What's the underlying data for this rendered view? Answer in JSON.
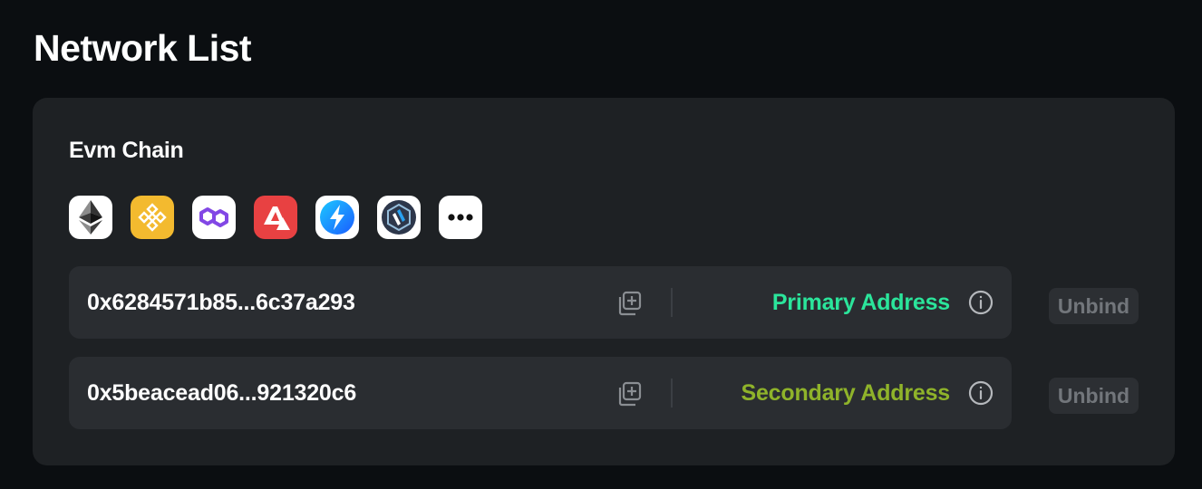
{
  "page": {
    "title": "Network List"
  },
  "evm": {
    "title": "Evm Chain",
    "chains": [
      {
        "icon": "ethereum-icon",
        "bg": "#ffffff"
      },
      {
        "icon": "bnb-icon",
        "bg": "#f3ba2f"
      },
      {
        "icon": "polygon-icon",
        "bg": "#ffffff"
      },
      {
        "icon": "avalanche-icon",
        "bg": "#e84142"
      },
      {
        "icon": "zksync-icon",
        "bg": "#ffffff"
      },
      {
        "icon": "arbitrum-icon",
        "bg": "#ffffff"
      },
      {
        "icon": "more-icon",
        "bg": "#ffffff"
      }
    ]
  },
  "addresses": [
    {
      "address": "0x6284571b85...6c37a293",
      "type": "Primary Address",
      "type_color": "#2be59b",
      "action": "Unbind"
    },
    {
      "address": "0x5beacead06...921320c6",
      "type": "Secondary Address",
      "type_color": "#8fb32a",
      "action": "Unbind"
    }
  ],
  "colors": {
    "background": "#0b0e11",
    "card": "#1e2124",
    "row": "#2a2d31"
  }
}
